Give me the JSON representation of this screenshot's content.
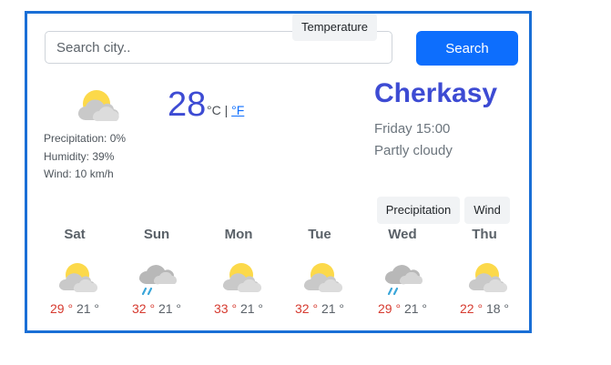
{
  "search": {
    "placeholder": "Search city..",
    "button_label": "Search"
  },
  "current": {
    "icon": "partly-cloudy-icon",
    "temperature": "28",
    "unit_c": "°C",
    "separator": "|",
    "unit_f": "°F",
    "precipitation": "Precipitation: 0%",
    "humidity": "Humidity: 39%",
    "wind": "Wind: 10 km/h",
    "city": "Cherkasy",
    "datetime": "Friday 15:00",
    "condition": "Partly cloudy"
  },
  "tabs": [
    {
      "label": "Temperature"
    },
    {
      "label": "Precipitation"
    },
    {
      "label": "Wind"
    }
  ],
  "forecast": [
    {
      "day": "Sat",
      "icon": "partly-cloudy-icon",
      "max": "29 °",
      "min": "21 °"
    },
    {
      "day": "Sun",
      "icon": "rain-cloud-icon",
      "max": "32 °",
      "min": "21 °"
    },
    {
      "day": "Mon",
      "icon": "partly-cloudy-icon",
      "max": "33 °",
      "min": "21 °"
    },
    {
      "day": "Tue",
      "icon": "partly-cloudy-icon",
      "max": "32 °",
      "min": "21 °"
    },
    {
      "day": "Wed",
      "icon": "rain-cloud-icon",
      "max": "29 °",
      "min": "21 °"
    },
    {
      "day": "Thu",
      "icon": "partly-cloudy-icon",
      "max": "22 °",
      "min": "18 °"
    }
  ],
  "colors": {
    "accent": "#0d6efd",
    "frame": "#1a6fd6",
    "heading": "#3d4bd3",
    "max_temp": "#d63a2f"
  }
}
